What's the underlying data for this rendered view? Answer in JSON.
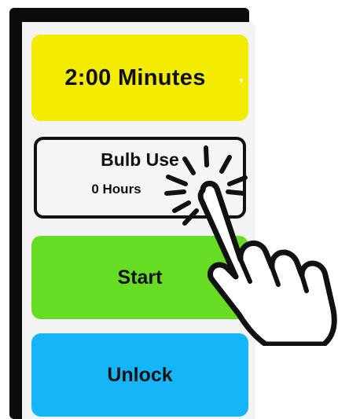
{
  "timer": {
    "label": "2:00 Minutes",
    "dropdown_caret": "▾"
  },
  "bulb_use": {
    "title": "Bulb Use",
    "value": "0 Hours"
  },
  "start_button": {
    "label": "Start"
  },
  "unlock_button": {
    "label": "Unlock"
  },
  "colors": {
    "timer_tile": "#f4ec00",
    "start_tile": "#66dd22",
    "unlock_tile": "#15b6f7",
    "bulb_tile_border": "#111111"
  },
  "overlay": {
    "icon": "pointing-hand-tap-icon"
  }
}
